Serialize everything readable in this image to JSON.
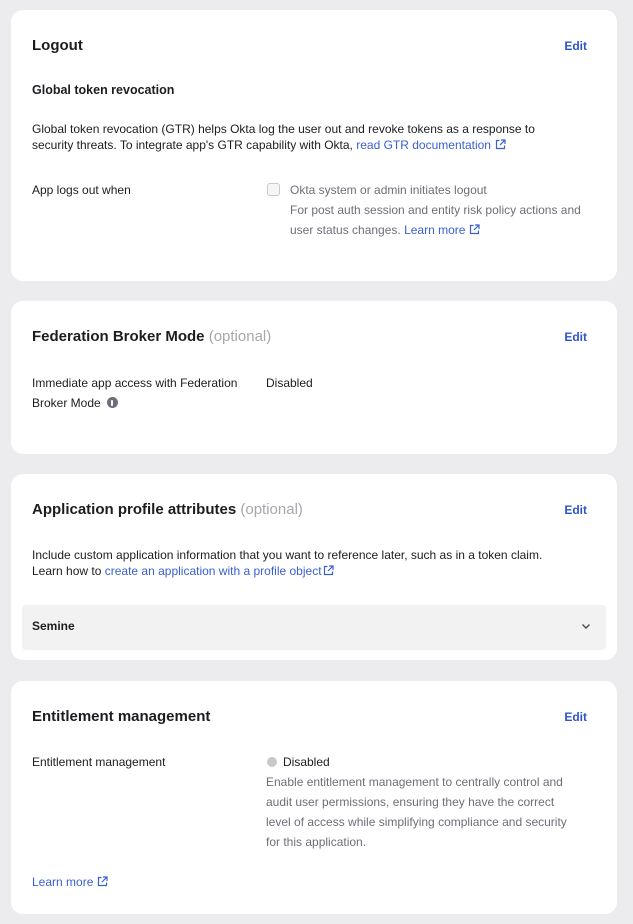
{
  "logout": {
    "title": "Logout",
    "edit_label": "Edit",
    "subtitle": "Global token revocation",
    "description_line1": "Global token revocation (GTR) helps Okta log the user out and revoke tokens as a response to",
    "description_line2_prefix": "security threats. To integrate app's GTR capability with Okta,",
    "description_link": "read GTR documentation",
    "row_label": "App logs out when",
    "checkbox_label": "Okta system or admin initiates logout",
    "checkbox_checked": false,
    "help_line1": "For post auth session and entity risk policy actions and",
    "help_line2_prefix": "user status changes.",
    "help_link": "Learn more"
  },
  "federation": {
    "title": "Federation Broker Mode",
    "optional_label": "(optional)",
    "edit_label": "Edit",
    "row_label_line1": "Immediate app access with Federation",
    "row_label_line2": "Broker Mode",
    "value": "Disabled"
  },
  "profile_attributes": {
    "title": "Application profile attributes",
    "optional_label": "(optional)",
    "edit_label": "Edit",
    "description_line1": "Include custom application information that you want to reference later, such as in a token claim.",
    "description_line2_prefix": "Learn how to",
    "description_link": "create an application with a profile object",
    "accordion_label": "Semine"
  },
  "entitlement": {
    "title": "Entitlement management",
    "edit_label": "Edit",
    "row_label": "Entitlement management",
    "status": "Disabled",
    "desc_line1": "Enable entitlement management to centrally control and",
    "desc_line2": "audit user permissions, ensuring they have the correct",
    "desc_line3": "level of access while simplifying compliance and security",
    "desc_line4": "for this application.",
    "learn_more": "Learn more"
  },
  "colors": {
    "link": "#3a5fd0",
    "edit": "#2f55c4",
    "background": "#ececee",
    "card": "#ffffff",
    "status_disabled": "#c7c7cc"
  }
}
